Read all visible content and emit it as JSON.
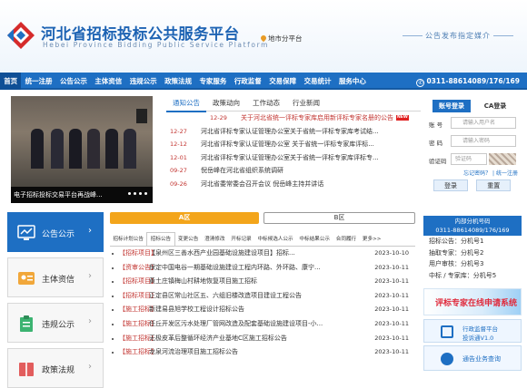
{
  "header": {
    "title": "河北省招标投标公共服务平台",
    "subtitle": "Hebei Province Bidding Public Service Platform",
    "city_link": "地市分平台",
    "slogan": "公告发布指定媒介"
  },
  "nav": {
    "items": [
      "首页",
      "统一注册",
      "公告公示",
      "主体资信",
      "违规公示",
      "政策法规",
      "专家服务",
      "行政监督",
      "交易保障",
      "交易统计",
      "服务中心"
    ],
    "active_index": 0,
    "phone": "0311-88614089/176/169"
  },
  "slider": {
    "caption": "电子招标投标交易平台再战峰..."
  },
  "news": {
    "tabs": [
      "通知公告",
      "政策动向",
      "工作动态",
      "行业新闻"
    ],
    "active_tab": 0,
    "items": [
      {
        "date": "12-29",
        "title": "关于河北省统一评标专家库启用新评标专家名册的公告",
        "highlight": true,
        "is_new": true
      },
      {
        "date": "12-27",
        "title": "河北省评标专家认证管理办公室关于省统一评标专家库考试结...",
        "highlight": false,
        "is_new": false
      },
      {
        "date": "12-12",
        "title": "河北省评标专家认证管理办公室 关于省统一评标专家库评标...",
        "highlight": false,
        "is_new": false
      },
      {
        "date": "12-01",
        "title": "河北省评标专家认证管理办公室关于省统一评标专家库评标专...",
        "highlight": false,
        "is_new": false
      },
      {
        "date": "09-27",
        "title": "倪岳峰在河北省组织系统调研",
        "highlight": false,
        "is_new": false
      },
      {
        "date": "09-26",
        "title": "河北省委常委会召开会议 倪岳峰主持并讲话",
        "highlight": false,
        "is_new": false
      }
    ],
    "new_badge": "NEW"
  },
  "login": {
    "tab_account": "账号登录",
    "tab_ca": "CA登录",
    "account_label": "账 号",
    "account_placeholder": "请输入用户名",
    "password_label": "密 码",
    "password_placeholder": "请输入密码",
    "captcha_label": "验证码",
    "captcha_placeholder": "验证码",
    "forgot": "忘记密码？",
    "register": "统一注册",
    "login_button": "登录",
    "reset_button": "重置"
  },
  "sidebar": {
    "items": [
      "公告公示",
      "主体资信",
      "违规公示",
      "政策法规"
    ],
    "active_index": 0
  },
  "tender": {
    "section_a": "A区",
    "section_b": "B区",
    "tabs": [
      "招标计划公告",
      "招标公告",
      "变更公告",
      "澄清修改",
      "开标记录",
      "中标候选人公示",
      "中标结果公示",
      "合同履行",
      "更多>>"
    ],
    "active_tab": 1,
    "rows": [
      {
        "tag": "【招标项目】",
        "title": "【泉州区三善水西产业园基础设施建设项目】招标...",
        "date": "2023-10-10"
      },
      {
        "tag": "【资审公告】",
        "title": "保定中国电谷一期基础设施建设工程内环路、外环路、康宁...",
        "date": "2023-10-11"
      },
      {
        "tag": "【招标项目】",
        "title": "黄土庄镇梅山村耕地恢复项目施工招标",
        "date": "2023-10-11"
      },
      {
        "tag": "【招标项目】",
        "title": "正定县区常山社区五、六组旧楼改造项目建设工程公告",
        "date": "2023-10-11"
      },
      {
        "tag": "【施工招标】",
        "title": "新建易县旭学校工程设计招标公告",
        "date": "2023-10-11"
      },
      {
        "tag": "【施工招标】",
        "title": "任丘开发区污水处理厂管网改造及配套基础设施建设项目-小...",
        "date": "2023-10-11"
      },
      {
        "tag": "【施工招标】",
        "title": "无极皮革后整循环经济产业基地C区施工招标公告",
        "date": "2023-10-11"
      },
      {
        "tag": "【施工招标】",
        "title": "龙泉河流治理项目施工招标公告",
        "date": "2023-10-11"
      }
    ]
  },
  "area_box": {
    "title": "内部分机号码",
    "phone": "0311-88614089/176/169",
    "rows": [
      "招标公告：分机号1",
      "抽取专家：分机号2",
      "用户审核：分机号3",
      "中标 / 专家库：分机号5"
    ]
  },
  "banners": {
    "expert": "评标专家在线申请系统",
    "supervision_1": "行政监督平台",
    "supervision_2": "投诉通V1.0",
    "service": "通告业务查询"
  },
  "colors": {
    "nav_blue": "#1e6fc3",
    "accent_orange": "#f3a51b",
    "tag_red": "#c23430"
  }
}
